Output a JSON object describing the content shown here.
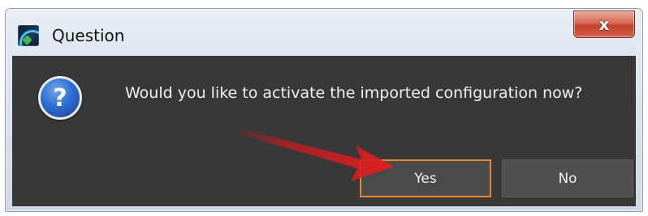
{
  "window": {
    "title": "Question",
    "close_glyph": "x",
    "app_icon": "app-logo-icon"
  },
  "dialog": {
    "icon": "question-mark-icon",
    "icon_glyph": "?",
    "message": "Would you like to activate the imported configuration now?",
    "buttons": {
      "yes": "Yes",
      "no": "No"
    },
    "focused_button": "yes"
  },
  "annotation": {
    "icon": "red-arrow-pointer",
    "color": "#d21a1a"
  },
  "colors": {
    "content_background": "#383838",
    "focus_border": "#e4892f",
    "close_button": "#c2402a"
  }
}
